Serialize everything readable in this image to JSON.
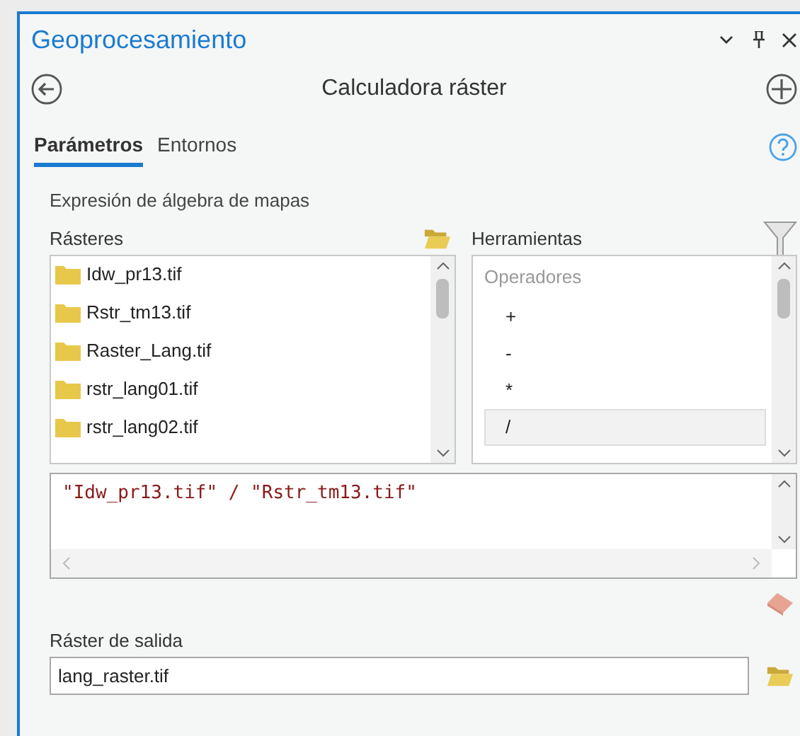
{
  "window": {
    "title": "Geoprocesamiento"
  },
  "tool": {
    "title": "Calculadora ráster"
  },
  "tabs": [
    {
      "label": "Parámetros",
      "selected": true
    },
    {
      "label": "Entornos",
      "selected": false
    }
  ],
  "expression_label": "Expresión de álgebra de mapas",
  "rasters": {
    "label": "Rásteres",
    "items": [
      "Idw_pr13.tif",
      "Rstr_tm13.tif",
      "Raster_Lang.tif",
      "rstr_lang01.tif",
      "rstr_lang02.tif"
    ]
  },
  "tools": {
    "label": "Herramientas",
    "group": "Operadores",
    "items": [
      {
        "label": "+",
        "selected": false
      },
      {
        "label": "-",
        "selected": false
      },
      {
        "label": "*",
        "selected": false
      },
      {
        "label": "/",
        "selected": true
      }
    ]
  },
  "expression": "\"Idw_pr13.tif\" / \"Rstr_tm13.tif\"",
  "output": {
    "label": "Ráster de salida",
    "value": "lang_raster.tif"
  }
}
